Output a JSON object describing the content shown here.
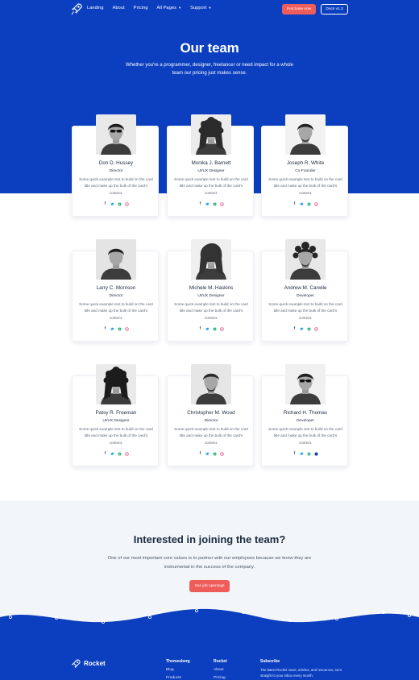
{
  "nav": {
    "logo_icon": "rocket-icon",
    "links": [
      {
        "label": "Landing"
      },
      {
        "label": "About"
      },
      {
        "label": "Pricing"
      },
      {
        "label": "All Pages",
        "dropdown": true
      },
      {
        "label": "Support",
        "dropdown": true
      }
    ],
    "purchase_label": "Purchase now",
    "docs_label": "Docs v1.3"
  },
  "hero": {
    "title": "Our team",
    "subtitle": "Whether you're a programmer, designer, freelancer or need impact for a whole team our pricing just makes sense."
  },
  "members": [
    {
      "name": "Don D. Hussey",
      "role": "Director",
      "text": "Some quick example text to build on the card title and make up the bulk of the card's content."
    },
    {
      "name": "Monika J. Barnett",
      "role": "UI/UX Designer",
      "text": "Some quick example text to build on the card title and make up the bulk of the card's content."
    },
    {
      "name": "Joseph R. White",
      "role": "Co-Founder",
      "text": "Some quick example text to build on the card title and make up the bulk of the card's content."
    },
    {
      "name": "Larry C. Morrison",
      "role": "Director",
      "text": "Some quick example text to build on the card title and make up the bulk of the card's content."
    },
    {
      "name": "Michele M. Haskins",
      "role": "UI/UX Designer",
      "text": "Some quick example text to build on the card title and make up the bulk of the card's content."
    },
    {
      "name": "Andrew M. Carwile",
      "role": "Developer",
      "text": "Some quick example text to build on the card title and make up the bulk of the card's content."
    },
    {
      "name": "Patsy R. Freeman",
      "role": "UI/UX Designer",
      "text": "Some quick example text to build on the card title and make up the bulk of the card's content."
    },
    {
      "name": "Christopher M. Wood",
      "role": "Director",
      "text": "Some quick example text to build on the card title and make up the bulk of the card's content."
    },
    {
      "name": "Richard H. Thomas",
      "role": "Developer",
      "text": "Some quick example text to build on the card title and make up the bulk of the card's content."
    }
  ],
  "social_icons": [
    "facebook-icon",
    "twitter-icon",
    "skype-icon",
    "dribbble-icon"
  ],
  "join": {
    "title": "Interested in joining the team?",
    "text": "One of our most important core values is to partner with our employees because we know they are instrumental in the success of the company.",
    "button_label": "See job openings"
  },
  "footer": {
    "brand": "Rocket",
    "col1": [
      "Themesberg",
      "Blog",
      "Products"
    ],
    "col2": [
      "Rocket",
      "About",
      "Pricing"
    ],
    "subscribe_title": "Subscribe",
    "subscribe_text": "The latest Rocket news, articles, and resources, sent straight to your inbox every month."
  },
  "colors": {
    "brand_blue": "#0b3fbf",
    "accent_red": "#ef5d5b",
    "light_section": "#f2f5fa"
  }
}
